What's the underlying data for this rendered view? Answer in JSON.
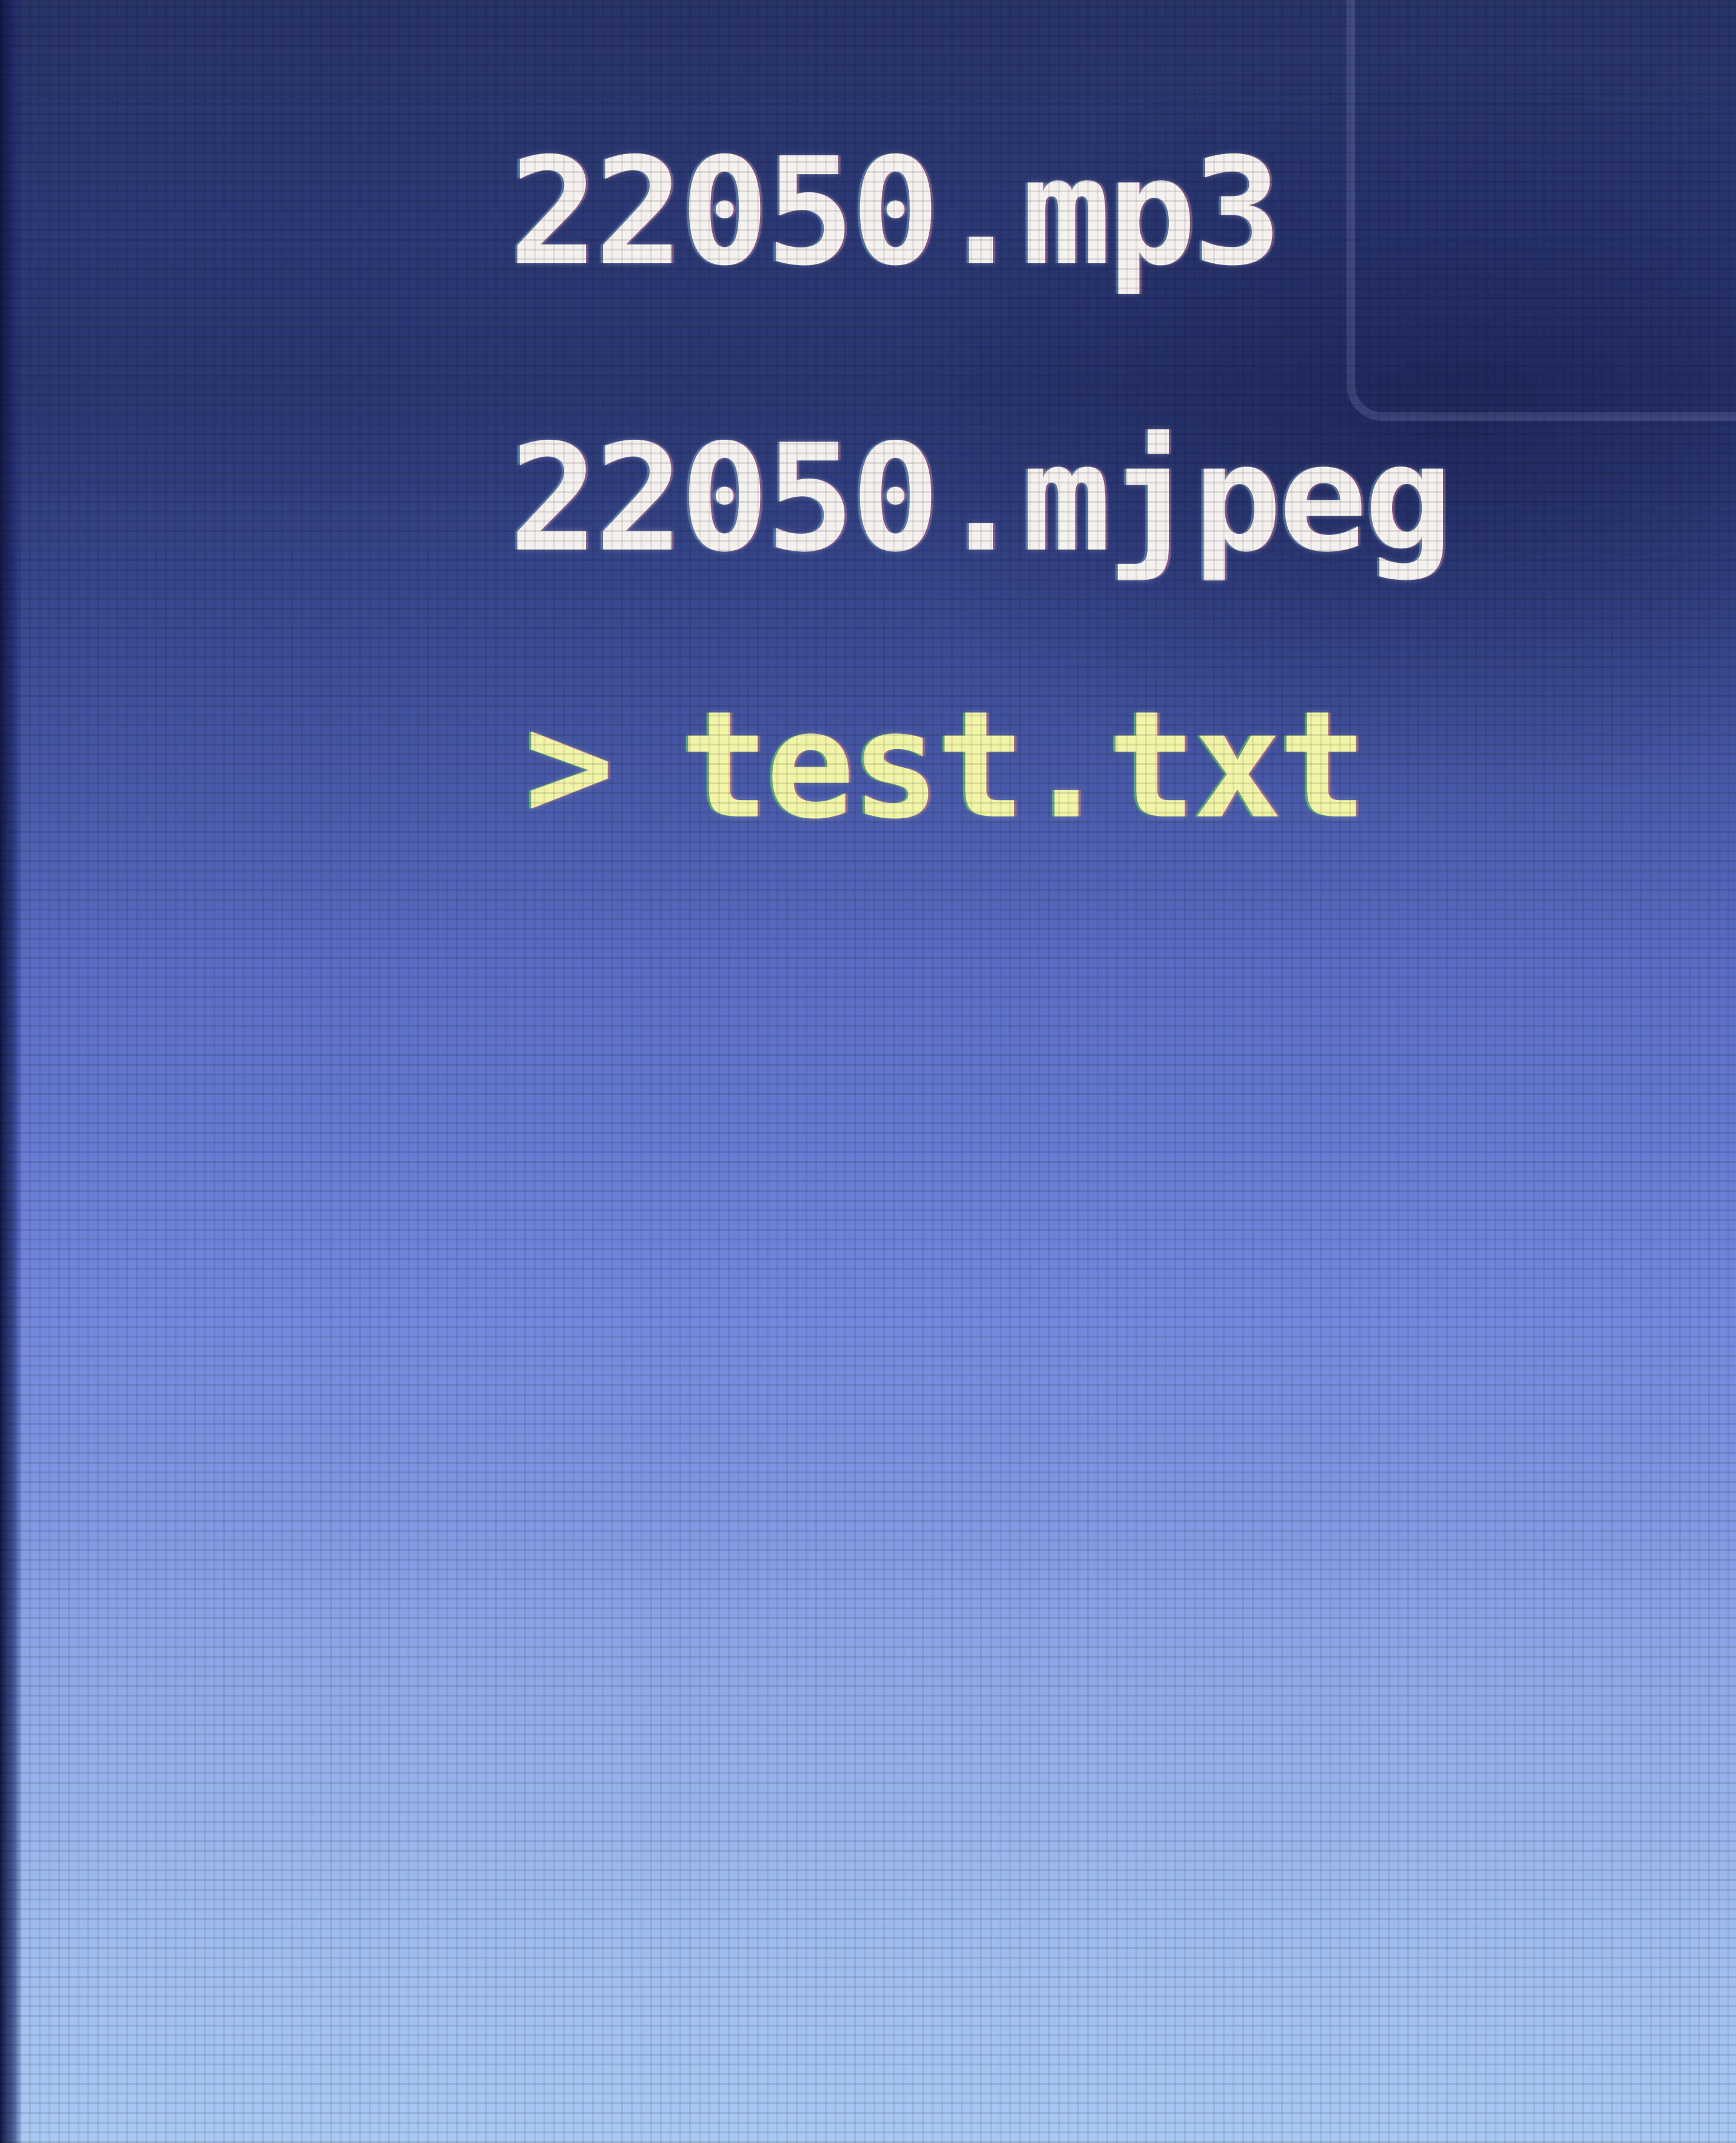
{
  "file_browser": {
    "files": [
      {
        "name": "22050.mp3",
        "selected": false
      },
      {
        "name": "22050.mjpeg",
        "selected": false
      },
      {
        "name": "test.txt",
        "selected": true
      }
    ],
    "cursor_symbol": ">"
  },
  "colors": {
    "background_top": "#283366",
    "background_bottom": "#a9c8f2",
    "file_text": "#f4f1ee",
    "selected_text": "#f2f5a8"
  }
}
